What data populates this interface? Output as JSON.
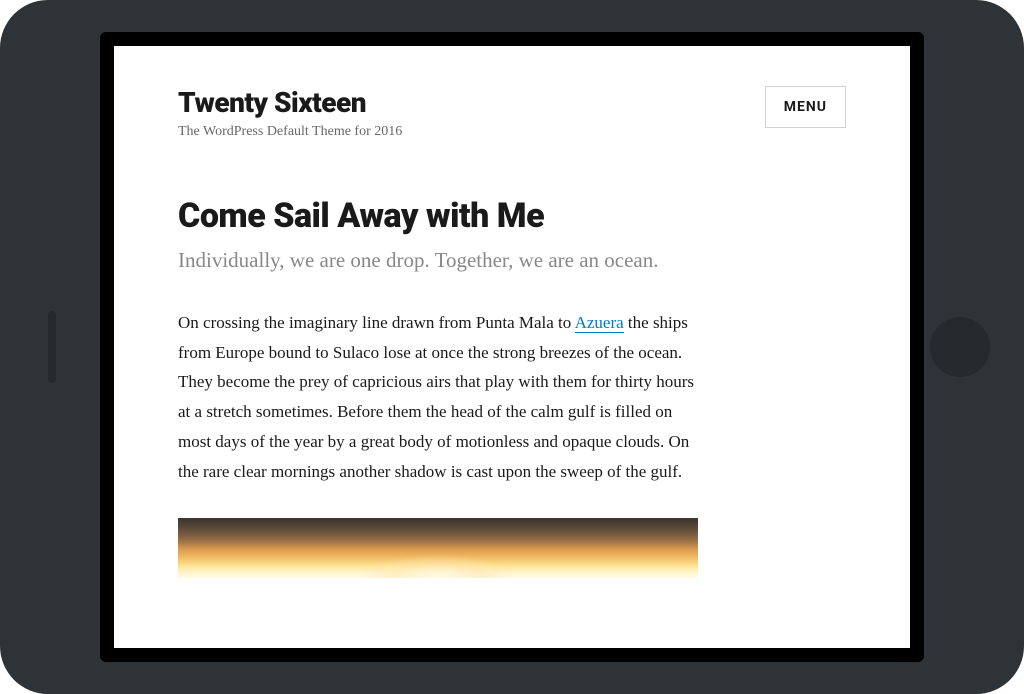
{
  "site": {
    "title": "Twenty Sixteen",
    "tagline": "The WordPress Default Theme for 2016"
  },
  "menu": {
    "label": "MENU"
  },
  "post": {
    "title": "Come Sail Away with Me",
    "subtitle": "Individually, we are one drop. Together, we are an ocean.",
    "body_before_link": "On crossing the imaginary line drawn from Punta Mala to ",
    "link_text": "Azuera",
    "body_after_link": " the ships from Europe bound to Sulaco lose at once the strong breezes of the ocean. They become the prey of capricious airs that play with them for thirty hours at a stretch sometimes. Before them the head of the calm gulf is filled on most days of the year by a great body of motionless and opaque clouds. On the rare clear mornings another shadow is cast upon the sweep of the gulf."
  }
}
